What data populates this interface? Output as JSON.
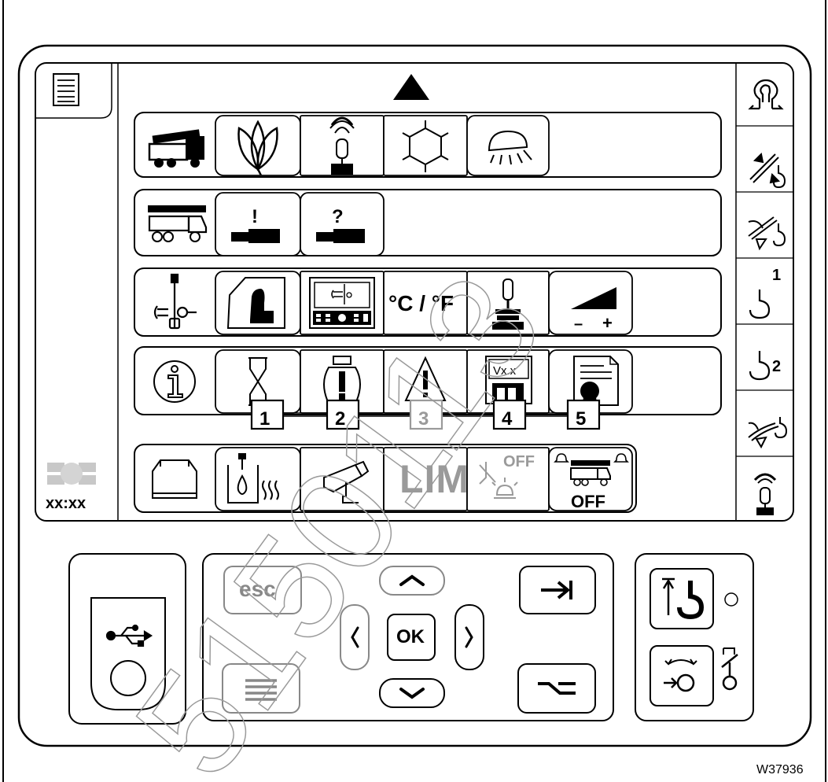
{
  "colors": {
    "stroke": "#000000",
    "background": "#ffffff",
    "watermark": "#bfbfbf",
    "badge_dim": "#9a9a9a"
  },
  "screen": {
    "nav_up_icon": "triangle-up-icon",
    "clock": "xx:xx",
    "rows": [
      {
        "name": "crane-carrier",
        "icons": [
          "crane-truck-icon",
          "eco-leaf-icon",
          "remote-control-icon",
          "snowflake-icon",
          "work-light-icon"
        ]
      },
      {
        "name": "outrigger",
        "icons": [
          "crane-outrigger-icon",
          "outrigger-warning-icon",
          "outrigger-help-icon"
        ]
      },
      {
        "name": "settings",
        "icons": [
          "settings-joystick-icon",
          "seat-icon",
          "display-settings-icon",
          "temperature-unit-text",
          "joystick-icon",
          "brightness-icon"
        ]
      },
      {
        "name": "info",
        "icons": [
          "info-icon",
          "hourglass-icon",
          "engine-warning-icon",
          "warning-triangle-icon",
          "software-version-icon",
          "certificate-icon"
        ]
      },
      {
        "name": "misc",
        "icons": [
          "toolbox-icon",
          "heater-icon",
          "camera-icon",
          "lim-text",
          "beacon-off-icon",
          "crane-alarm-off-icon"
        ]
      }
    ],
    "temp_label": "°C / °F",
    "brightness_minus": "–",
    "brightness_plus": "+",
    "version_label": "Vx.x",
    "lim_label": "LIM",
    "beacon_off_label": "OFF",
    "crane_off_label": "OFF",
    "badges": [
      "1",
      "2",
      "3",
      "4",
      "5"
    ],
    "right_strip_icons": [
      "slewing-icon",
      "telescope-hook-icon",
      "luffing-hook-icon",
      "hook-1-icon",
      "hook-2-icon",
      "luffing-jib-icon",
      "remote-control-icon"
    ],
    "hook_1_index": "1",
    "hook_2_index": "2"
  },
  "controls": {
    "usb_icon": "usb-icon",
    "esc_label": "esc",
    "ok_label": "OK",
    "menu_icon": "menu-lines-icon",
    "tab_icon": "tab-arrow-icon",
    "shift_icon": "alt-switch-icon"
  },
  "footer": {
    "figure_id": "W37936",
    "watermark": "5150113"
  }
}
